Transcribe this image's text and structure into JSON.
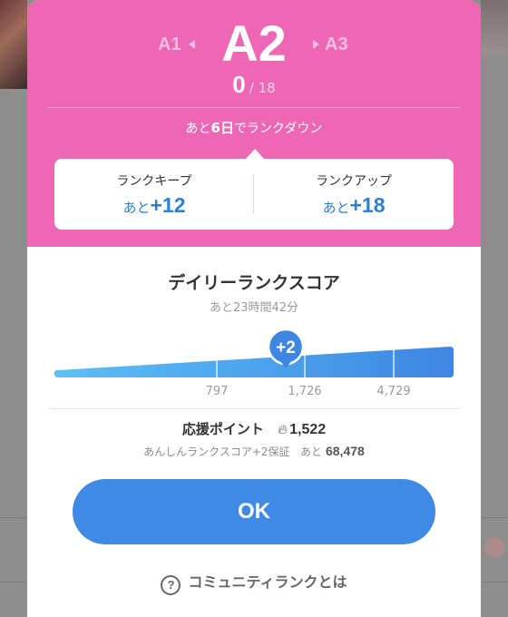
{
  "rank": {
    "previous": "A1",
    "current": "A2",
    "next": "A3",
    "score": "0",
    "score_total": "/ 18"
  },
  "rank_down": {
    "prefix": "あと",
    "days": "6日",
    "suffix": "でランクダウン"
  },
  "rank_keep": {
    "label": "ランクキープ",
    "prefix": "あと",
    "value": "+12"
  },
  "rank_up": {
    "label": "ランクアップ",
    "prefix": "あと",
    "value": "+18"
  },
  "daily": {
    "title": "デイリーランクスコア",
    "remaining": "あと23時間42分",
    "current_badge": "+2",
    "current_position_value": 1522,
    "thresholds": [
      "797",
      "1,726",
      "4,729"
    ],
    "bar_colors": {
      "start": "#5cc0f5",
      "end": "#3d86e3"
    }
  },
  "support": {
    "label": "応援ポイント",
    "icon": "flame-icon",
    "points": "1,522",
    "guarantee_label": "あんしんランクスコア+2保証",
    "guarantee_prefix": "あと",
    "guarantee_amount": "68,478"
  },
  "ok_label": "OK",
  "help": {
    "icon": "?",
    "label": "コミュニティランクとは"
  },
  "colors": {
    "header": "#ed67b5",
    "accent": "#3f8ae6",
    "value_text": "#2f7fd6"
  }
}
